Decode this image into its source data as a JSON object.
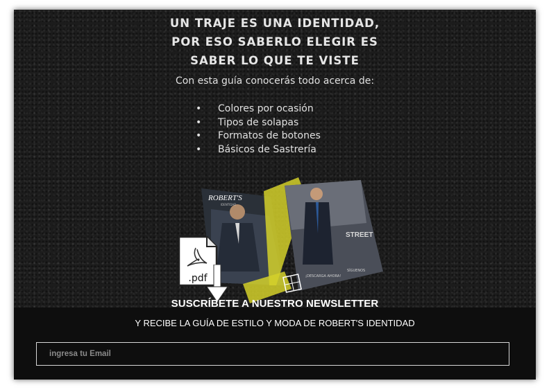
{
  "headline": {
    "line1": "UN TRAJE ES UNA IDENTIDAD,",
    "line2": "POR ESO SABERLO ELEGIR ES",
    "line3": "SABER LO QUE TE VISTE"
  },
  "intro": "Con esta guía conocerás todo acerca de:",
  "topics": [
    "Colores por ocasión",
    "Tipos de solapas",
    "Formatos de botones",
    "Básicos de Sastrería"
  ],
  "brochure": {
    "brand": "ROBERT'S",
    "logo_sub": "IDENTIDAD",
    "side_text": "STREET",
    "footer_left": "¡DESCARGA AHORA!",
    "footer_right": "SÍGUENOS"
  },
  "pdf_icon": {
    "icon": "pdf-file-icon",
    "label": ".pdf"
  },
  "download_icon": "down-arrow-icon",
  "newsletter": {
    "title": "SUSCRÍBETE A NUESTRO NEWSLETTER",
    "subtitle": "Y RECIBE LA GUÍA DE ESTILO Y MODA DE ROBERT'S IDENTIDAD"
  },
  "email_field": {
    "placeholder": "ingresa tu Email",
    "value": ""
  },
  "colors": {
    "background": "#1c1c1c",
    "band": "#0e0e0e",
    "text": "#e6e6e6",
    "accent": "#d4d02a"
  }
}
